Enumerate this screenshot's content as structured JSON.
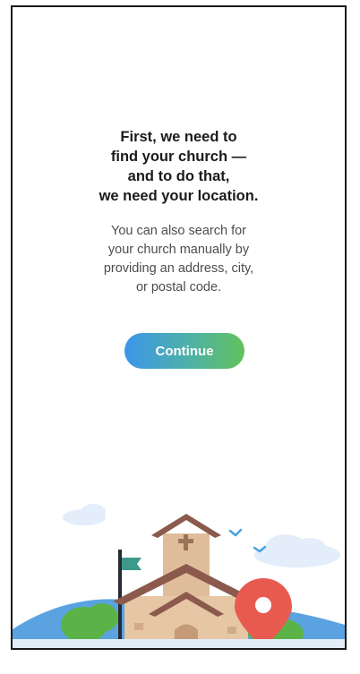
{
  "intro": {
    "heading_lines": [
      "First, we need to",
      "find your church —",
      "and to do that,",
      "we need your location."
    ],
    "body_lines": [
      "You can also search for",
      "your church manually by",
      "providing an address, city,",
      "or postal code."
    ],
    "continue_label": "Continue"
  },
  "colors": {
    "button_gradient_start": "#3d95ea",
    "button_gradient_end": "#62c15c",
    "pin": "#e85a4f",
    "church_wall": "#e6c6a4",
    "roof": "#8b5a4c"
  },
  "illustration": {
    "icons": [
      "church-icon",
      "location-pin-icon",
      "flag-icon",
      "bird-icon",
      "cloud-icon",
      "cross-icon"
    ]
  }
}
